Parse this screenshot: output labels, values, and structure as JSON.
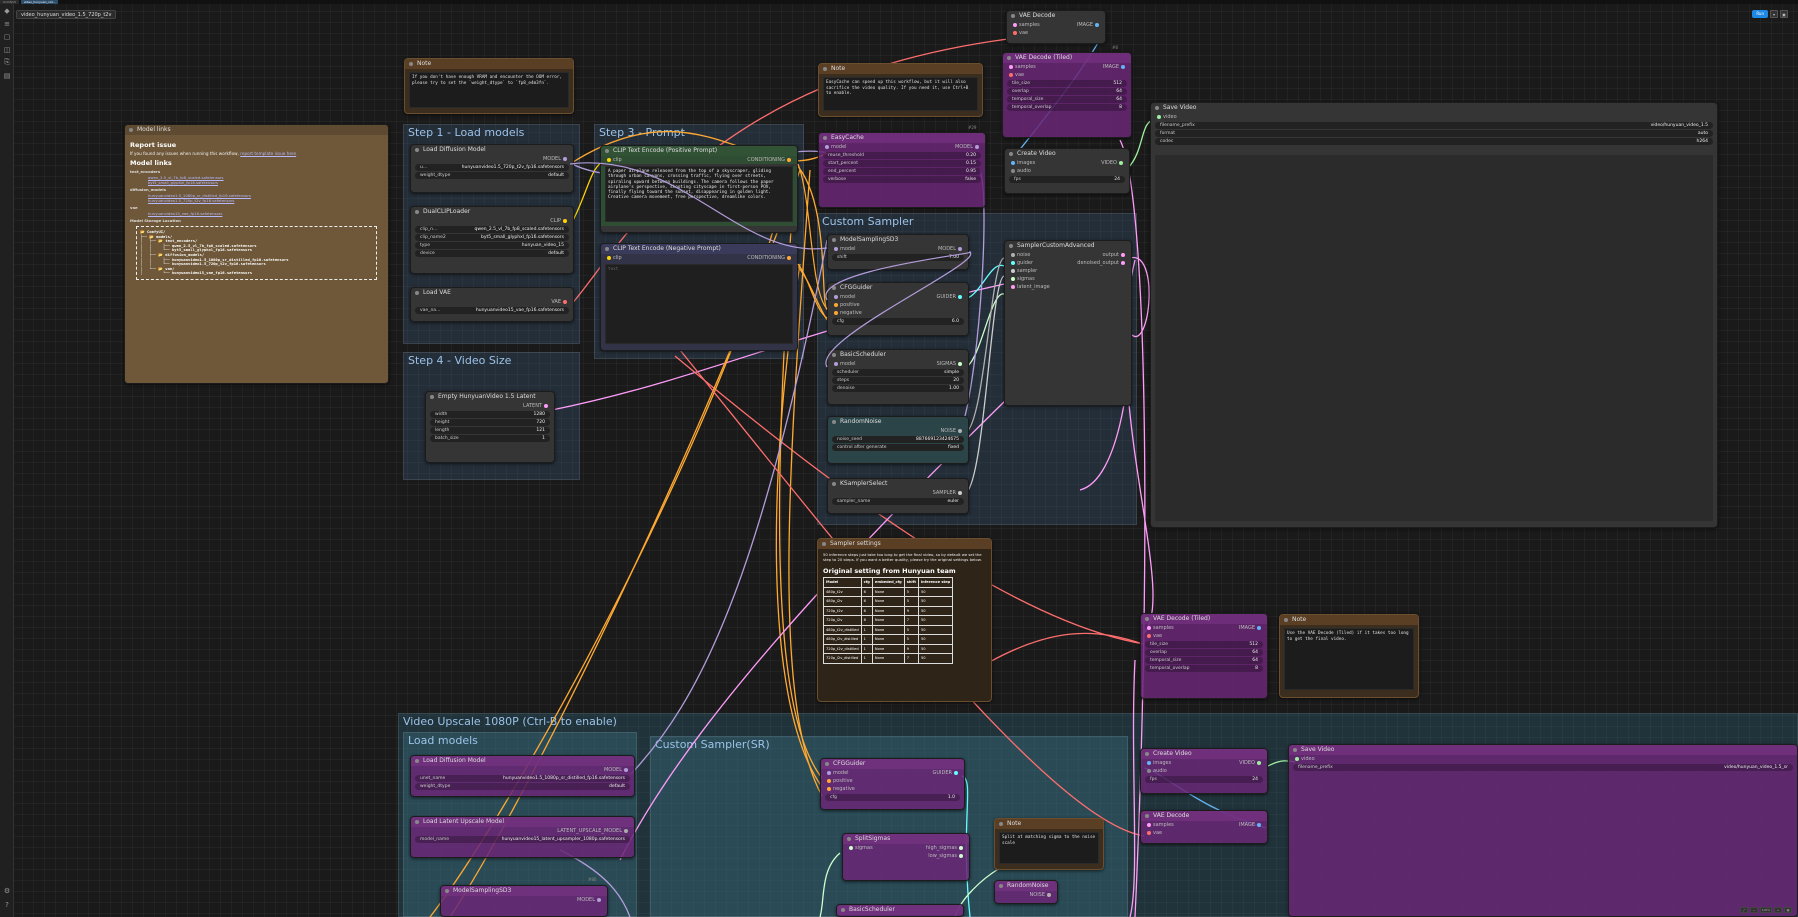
{
  "app": {
    "tabs": [
      "ComfyUI",
      "video_hunyuan_vid..."
    ],
    "workflow_tab": "video_hunyuan_video_1.5_720p_t2v",
    "run_label": "Run",
    "sidebar_icons": [
      "logo-icon",
      "queue-icon",
      "node-library-icon",
      "model-library-icon",
      "workflows-icon",
      "templates-icon",
      "settings-icon",
      "help-icon"
    ]
  },
  "groups": {
    "step1": "Step 1 - Load models",
    "step3": "Step 3 - Prompt",
    "step4": "Step 4 - Video Size",
    "custom_sampler": "Custom Sampler",
    "upscale": "Video Upscale 1080P (Ctrl-B to enable)",
    "load_models2": "Load models",
    "custom_sampler_sr": "Custom Sampler(SR)"
  },
  "model_links": {
    "title": "Model links",
    "report_h": "Report issue",
    "report_p": "If you found any issues when running this workflow, ",
    "report_link": "report template issue here",
    "links_h": "Model links",
    "te_h": "text_encoders",
    "te": [
      "qwen_2.5_vl_7b_fp8_scaled.safetensors",
      "byt5_small_glyphxl_fp16.safetensors"
    ],
    "dm_h": "diffusion_models",
    "dm": [
      "hunyuanvideo1.5_1080p_sr_distilled_fp16.safetensors",
      "hunyuanvideo1.5_720p_t2v_fp16.safetensors"
    ],
    "vae_h": "vae",
    "vae": [
      "hunyuanvideo15_vae_fp16.safetensors"
    ],
    "storage_h": "Model Storage Location",
    "tree": "📂 ComfyUI/\n├── 📂 models/\n│   ├── 📂 text_encoders/\n│   │     ├── qwen_2.5_vl_7b_fp8_scaled.safetensors\n│   │     └── byt5_small_glyphxl_fp16.safetensors\n│   ├── 📂 diffusion_models/\n│   │     ├── hunyuanvideo1.5_1080p_sr_distilled_fp16.safetensors\n│   │     └── hunyuanvideo1.5_720p_t2v_fp16.safetensors\n│   └── 📂 vae/\n│         └── hunyuanvideo15_vae_fp16.safetensors"
  },
  "note1": {
    "title": "Note",
    "text": "If you don't have enough VRAM and encounter the OOM error, please try to set the `weight_dtype` to `fp8_e4m3fn`."
  },
  "note2": {
    "title": "Note",
    "text": "EasyCache can speed up this workflow, but it will also sacrifice the video quality. If you need it, use Ctrl+B to enable."
  },
  "note3": {
    "title": "Note",
    "text": "Use the VAE Decode (Tiled) if it takes too long to get the final video."
  },
  "note4": {
    "title": "Note",
    "text": "Split at matching sigma to the noise scale"
  },
  "load_diffusion": {
    "title": "Load Diffusion Model",
    "out": "MODEL",
    "unet": "u...",
    "unet_v": "hunyuanvideo1.5_720p_t2v_fp16.safetensors",
    "dtype": "weight_dtype",
    "dtype_v": "default"
  },
  "dualclip": {
    "title": "DualCLIPLoader",
    "out": "CLIP",
    "c1": "clip_n...",
    "c1_v": "qwen_2.5_vl_7b_fp8_scaled.safetensors",
    "c2": "clip_name2",
    "c2_v": "byt5_small_glyphxl_fp16.safetensors",
    "type": "type",
    "type_v": "hunyuan_video_15",
    "device": "device",
    "device_v": "default"
  },
  "loadvae": {
    "title": "Load VAE",
    "out": "VAE",
    "n": "vae_na...",
    "v": "hunyuanvideo15_vae_fp16.safetensors"
  },
  "clip_pos": {
    "title": "CLIP Text Encode (Positive Prompt)",
    "in": "clip",
    "out": "CONDITIONING",
    "text": "A paper airplane released from the top of a skyscraper, gliding through urban canyons, crossing traffic, flying over streets, spiraling upward between buildings. The camera follows the paper airplane's perspective, shooting cityscape in first-person POV, finally flying toward the sunset, disappearing in golden light. Creative camera movement, free perspective, dreamlike colors."
  },
  "clip_neg": {
    "title": "CLIP Text Encode (Negative Prompt)",
    "in": "clip",
    "out": "CONDITIONING",
    "placeholder": "text"
  },
  "latent": {
    "title": "Empty HunyuanVideo 1.5 Latent",
    "out": "LATENT",
    "w": "width",
    "w_v": "1280",
    "h": "height",
    "h_v": "720",
    "l": "length",
    "l_v": "121",
    "b": "batch_size",
    "b_v": "1"
  },
  "easycache": {
    "title": "EasyCache",
    "in": "model",
    "out": "MODEL",
    "r1": "reuse_threshold",
    "r1v": "0.20",
    "r2": "start_percent",
    "r2v": "0.15",
    "r3": "end_percent",
    "r3v": "0.95",
    "r4": "verbose",
    "r4v": "false",
    "badge": "#29"
  },
  "modelsampling": {
    "title": "ModelSamplingSD3",
    "in": "model",
    "out": "MODEL",
    "s": "shift",
    "s_v": "7.00"
  },
  "cfgguider": {
    "title": "CFGGuider",
    "in1": "model",
    "in2": "positive",
    "in3": "negative",
    "out": "GUIDER",
    "c": "cfg",
    "c_v": "6.0"
  },
  "basicsched": {
    "title": "BasicScheduler",
    "in": "model",
    "out": "SIGMAS",
    "a": "scheduler",
    "a_v": "simple",
    "b": "steps",
    "b_v": "20",
    "c": "denoise",
    "c_v": "1.00"
  },
  "randomnoise": {
    "title": "RandomNoise",
    "out": "NOISE",
    "a": "noise_seed",
    "a_v": "887669123424675",
    "b": "control after generate",
    "b_v": "fixed"
  },
  "ksamplersel": {
    "title": "KSamplerSelect",
    "out": "SAMPLER",
    "a": "sampler_name",
    "a_v": "euler"
  },
  "samplercustom": {
    "title": "SamplerCustomAdvanced",
    "ins": [
      "noise",
      "guider",
      "sampler",
      "sigmas",
      "latent_image"
    ],
    "outs": [
      "output",
      "denoised_output"
    ]
  },
  "vaedecode": {
    "title": "VAE Decode",
    "in1": "samples",
    "in2": "vae",
    "out": "IMAGE"
  },
  "vaedecodetiled": {
    "title": "VAE Decode (Tiled)",
    "in1": "samples",
    "in2": "vae",
    "out": "IMAGE",
    "badge": "#8",
    "rows": [
      "tile_size",
      "overlap",
      "temporal_size",
      "temporal_overlap"
    ],
    "vals": [
      "512",
      "64",
      "64",
      "8"
    ]
  },
  "createvideo": {
    "title": "Create Video",
    "in1": "images",
    "in2": "audio",
    "out": "VIDEO",
    "f": "fps",
    "f_v": "24"
  },
  "savevideo": {
    "title": "Save Video",
    "in": "video",
    "fp": "filename_prefix",
    "fp_v": "video/hunyuan_video_1.5",
    "fmt": "format",
    "fmt_v": "auto",
    "codec": "codec",
    "codec_v": "h264"
  },
  "sampler_settings": {
    "title": "Sampler settings",
    "text": "50 inference steps just take too long to get the final video, so by default we set the step to 20 steps. If you want a better quality, please try the original settings below.",
    "h": "Original setting from Hunyuan team",
    "headers": [
      "Model",
      "cfg",
      "embeded_cfg",
      "shift",
      "inference step"
    ],
    "rows": [
      [
        "480p_t2v",
        "6",
        "None",
        "5",
        "50"
      ],
      [
        "480p_i2v",
        "6",
        "None",
        "5",
        "50"
      ],
      [
        "720p_t2v",
        "6",
        "None",
        "9",
        "50"
      ],
      [
        "720p_i2v",
        "6",
        "None",
        "7",
        "50"
      ],
      [
        "480p_t2v_distilled",
        "1",
        "None",
        "5",
        "50"
      ],
      [
        "480p_i2v_distilled",
        "1",
        "None",
        "5",
        "50"
      ],
      [
        "720p_t2v_distilled",
        "1",
        "None",
        "9",
        "50"
      ],
      [
        "720p_i2v_distilled",
        "1",
        "None",
        "7",
        "50"
      ]
    ]
  },
  "sr": {
    "ld_title": "Load Diffusion Model",
    "ld_out": "MODEL",
    "ld_w1": "unet_name",
    "ld_w1v": "hunyuanvideo1.5_1080p_sr_distilled_fp16.safetensors",
    "ld_w2": "weight_dtype",
    "ld_w2v": "default",
    "lu_title": "Load Latent Upscale Model",
    "lu_out": "LATENT_UPSCALE_MODEL",
    "lu_w": "model_name",
    "lu_wv": "hunyuanvideo15_latent_upsampler_1080p.safetensors",
    "cfg_title": "CFGGuider",
    "cfg_ins": [
      "model",
      "positive",
      "negative"
    ],
    "cfg_out": "GUIDER",
    "cfg_w": "cfg",
    "cfg_wv": "1.0",
    "split_title": "SplitSigmas",
    "split_in": "sigmas",
    "split_out1": "high_sigmas",
    "split_out2": "low_sigmas",
    "vd2_title": "VAE Decode (Tiled)",
    "vd2_in1": "samples",
    "vd2_in2": "vae",
    "vd2_out": "IMAGE",
    "vd3_title": "VAE Decode",
    "vd3_in1": "samples",
    "vd3_in2": "vae",
    "vd3_out": "IMAGE",
    "cv2_title": "Create Video",
    "cv2_in1": "images",
    "cv2_in2": "audio",
    "cv2_out": "VIDEO",
    "cv2_w": "fps",
    "cv2_wv": "24",
    "sv2_title": "Save Video",
    "sv2_in": "video",
    "sv2_w": "filename_prefix",
    "sv2_wv": "video/hunyuan_video_1.5_sr",
    "ms_title": "ModelSamplingSD3",
    "ms_out": "MODEL",
    "ms_badge": "#80",
    "bs_title": "BasicScheduler",
    "rn_title": "RandomNoise",
    "rn_out": "NOISE"
  },
  "bottom": {
    "zoom": "100%"
  },
  "colors": {
    "model": "#b39ddb",
    "clip": "#ffd500",
    "conditioning": "#ffa931",
    "vae": "#ff6e6e",
    "latent": "#ff9cf9",
    "image": "#64b5f6",
    "guider": "#66ffff",
    "sigmas": "#cdffcd",
    "noise": "#b0b0b0",
    "video": "#9ef0a0",
    "note": "#6e5839"
  }
}
